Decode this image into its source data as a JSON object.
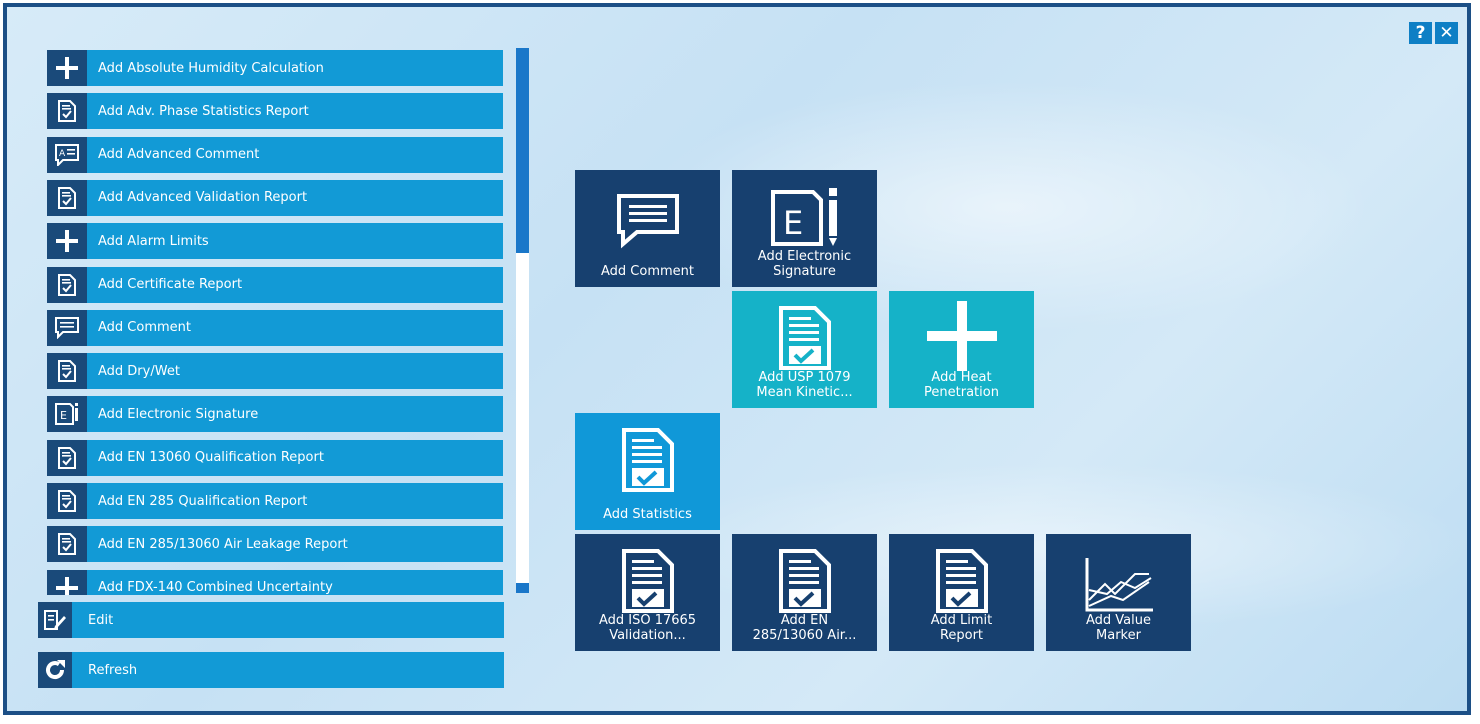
{
  "toolbar": {
    "help_label": "?",
    "close_label": "✕"
  },
  "list": {
    "items": [
      {
        "label": "Add Absolute Humidity Calculation",
        "icon": "plus-icon"
      },
      {
        "label": "Add Adv. Phase Statistics Report",
        "icon": "report-icon"
      },
      {
        "label": "Add Advanced Comment",
        "icon": "advanced-comment-icon"
      },
      {
        "label": "Add Advanced Validation Report",
        "icon": "report-icon"
      },
      {
        "label": "Add Alarm Limits",
        "icon": "plus-icon"
      },
      {
        "label": "Add Certificate Report",
        "icon": "report-icon"
      },
      {
        "label": "Add Comment",
        "icon": "comment-icon"
      },
      {
        "label": "Add Dry/Wet",
        "icon": "report-icon"
      },
      {
        "label": "Add Electronic Signature",
        "icon": "signature-icon"
      },
      {
        "label": "Add EN 13060 Qualification Report",
        "icon": "report-icon"
      },
      {
        "label": "Add EN 285 Qualification Report",
        "icon": "report-icon"
      },
      {
        "label": "Add EN 285/13060 Air Leakage Report",
        "icon": "report-icon"
      },
      {
        "label": "Add FDX-140 Combined Uncertainty",
        "icon": "plus-icon"
      }
    ]
  },
  "actions": {
    "edit_label": "Edit",
    "refresh_label": "Refresh"
  },
  "tiles": [
    {
      "label": "Add Comment",
      "icon": "comment-icon",
      "color": "dark"
    },
    {
      "label": "Add Electronic\nSignature",
      "icon": "signature-icon",
      "color": "dark"
    },
    {
      "label": "Add USP 1079\nMean Kinetic...",
      "icon": "report-icon",
      "color": "teal"
    },
    {
      "label": "Add Heat\nPenetration",
      "icon": "plus-icon",
      "color": "teal"
    },
    {
      "label": "Add Statistics",
      "icon": "report-icon",
      "color": "blue"
    },
    {
      "label": "Add ISO 17665\nValidation...",
      "icon": "report-icon",
      "color": "dark"
    },
    {
      "label": "Add EN\n285/13060 Air...",
      "icon": "report-icon",
      "color": "dark"
    },
    {
      "label": "Add Limit\nReport",
      "icon": "report-icon",
      "color": "dark"
    },
    {
      "label": "Add Value\nMarker",
      "icon": "chart-icon",
      "color": "dark"
    }
  ],
  "colors": {
    "dark_tile": "#17406f",
    "teal_tile": "#15b2c8",
    "blue_tile": "#1098d8",
    "list_item": "#129ad6",
    "icon_bg": "#1a4a7a",
    "frame": "#1c4f86"
  }
}
